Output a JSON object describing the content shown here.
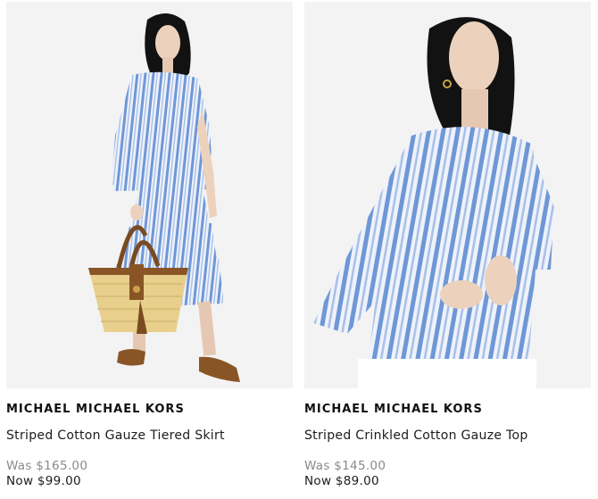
{
  "products": [
    {
      "brand": "MICHAEL MICHAEL KORS",
      "name": "Striped Cotton Gauze Tiered Skirt",
      "was_price": "Was $165.00",
      "now_price": "Now $99.00"
    },
    {
      "brand": "MICHAEL MICHAEL KORS",
      "name": "Striped Crinkled Cotton Gauze Top",
      "was_price": "Was $145.00",
      "now_price": "Now $89.00"
    }
  ],
  "colors": {
    "stripe_blue": "#6f97d6",
    "stripe_light": "#e8eef8",
    "image_bg": "#f3f3f3",
    "was_price": "#8a8a8a"
  }
}
